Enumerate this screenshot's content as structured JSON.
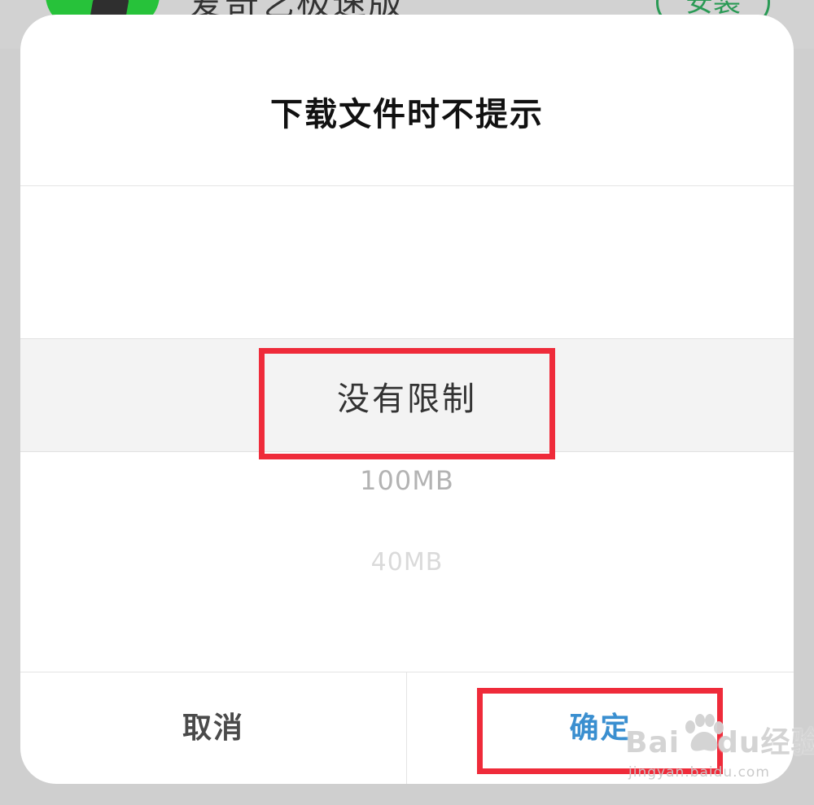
{
  "background": {
    "app_name": "爱奇艺极速版",
    "install_label": "安装"
  },
  "dialog": {
    "title": "下载文件时不提示",
    "picker": {
      "selected": "没有限制",
      "options": [
        "100MB",
        "40MB"
      ]
    },
    "buttons": {
      "cancel": "取消",
      "confirm": "确定"
    }
  },
  "watermark": {
    "brand_left": "Bai",
    "brand_right": "du",
    "brand_suffix": "经验",
    "url": "jingyan.baidu.com"
  },
  "colors": {
    "confirm": "#3a8fd0",
    "annotation": "#ef2b3a",
    "app_icon": "#27c23a"
  }
}
